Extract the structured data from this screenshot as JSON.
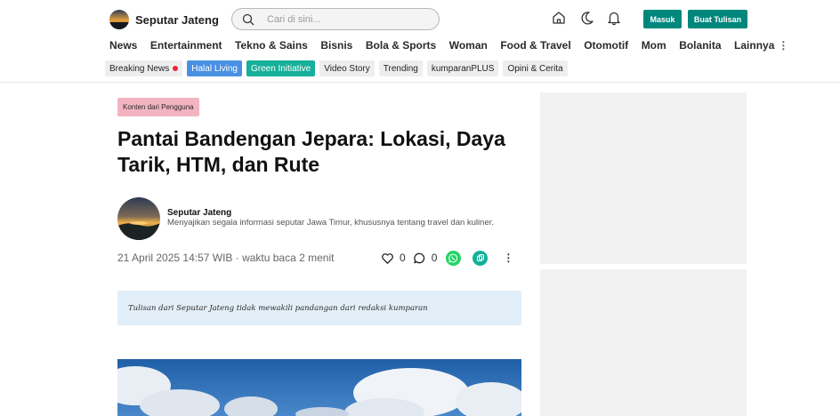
{
  "header": {
    "logo_text": "Seputar Jateng",
    "search_placeholder": "Cari di sini...",
    "login_label": "Masuk",
    "write_label": "Buat Tulisan",
    "icons": [
      "home-icon",
      "moon-icon",
      "bell-icon"
    ]
  },
  "nav": {
    "items": [
      "News",
      "Entertainment",
      "Tekno & Sains",
      "Bisnis",
      "Bola & Sports",
      "Woman",
      "Food & Travel",
      "Otomotif",
      "Mom",
      "Bolanita"
    ],
    "more_label": "Lainnya",
    "more_icon": "⋮"
  },
  "tags": [
    "Breaking News",
    "Halal Living",
    "Green Initiative",
    "Video Story",
    "Trending",
    "kumparanPLUS",
    "Opini & Cerita"
  ],
  "colors": {
    "accent": "#00877d",
    "tag_blue": "#4a90e2",
    "tag_green": "#15b09a",
    "badge_pink": "#f3b4c1",
    "live_dot": "#e8263c",
    "disclaimer_bg": "#e3eff8"
  },
  "article": {
    "badge": "Konten dari Pengguna",
    "title": "Pantai Bandengan Jepara: Lokasi, Daya Tarik, HTM, dan Rute",
    "author": {
      "name": "Seputar Jateng",
      "description": "Menyajikan segala informasi seputar Jawa Timur, khususnya tentang travel dan kuliner."
    },
    "meta": "21 April 2025 14:57 WIB · waktu baca 2 menit",
    "likes": "0",
    "comments": "0",
    "kebab": "⋮",
    "disclaimer": "Tulisan dari Seputar Jateng tidak mewakili pandangan dari redaksi kumparan"
  }
}
